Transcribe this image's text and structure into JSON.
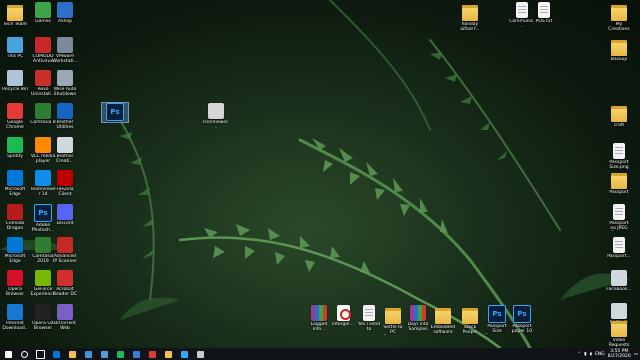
{
  "desktop": {
    "icons": [
      {
        "label": "Tech Team",
        "kind": "folder",
        "color": "#e8b740"
      },
      {
        "label": "Games",
        "kind": "app",
        "color": "#3fa34a"
      },
      {
        "label": "Ashop",
        "kind": "app",
        "color": "#2d6fc9"
      },
      {
        "label": "This PC",
        "kind": "app",
        "color": "#4aa3df"
      },
      {
        "label": "COMODO Antivirus",
        "kind": "app",
        "color": "#c62828"
      },
      {
        "label": "VMware Workstati...",
        "kind": "app",
        "color": "#7a8a9a"
      },
      {
        "label": "Recycle Bin",
        "kind": "app",
        "color": "#b0c4d8"
      },
      {
        "label": "Revo Uninstall...",
        "kind": "app",
        "color": "#c9302c"
      },
      {
        "label": "Wise Auto Shutdown",
        "kind": "app",
        "color": "#9aa7b4"
      },
      {
        "label": "Google Chrome",
        "kind": "app",
        "color": "#e53935"
      },
      {
        "label": "Camtasia 8",
        "kind": "app",
        "color": "#2e7d32"
      },
      {
        "label": "Brother Utilities",
        "kind": "app",
        "color": "#1565c0"
      },
      {
        "label": "Spotify",
        "kind": "app",
        "color": "#1db954"
      },
      {
        "label": "VLC media player",
        "kind": "app",
        "color": "#ff8800"
      },
      {
        "label": "Brother Creati...",
        "kind": "app",
        "color": "#cfd8dc"
      },
      {
        "label": "Microsoft Edge",
        "kind": "app",
        "color": "#0078d7"
      },
      {
        "label": "TeamViewer 14",
        "kind": "app",
        "color": "#0e8ee9"
      },
      {
        "label": "FileZilla Client",
        "kind": "app",
        "color": "#bf0000"
      },
      {
        "label": "Comodo Dragon",
        "kind": "app",
        "color": "#b71c1c"
      },
      {
        "label": "Adobe Photosh...",
        "kind": "ps",
        "color": "#31a8ff"
      },
      {
        "label": "Discord",
        "kind": "app",
        "color": "#5865f2"
      },
      {
        "label": "Microsoft Edge",
        "kind": "app",
        "color": "#0078d7"
      },
      {
        "label": "Camtasia 2019",
        "kind": "app",
        "color": "#2e7d32"
      },
      {
        "label": "Advanced IP Scanner",
        "kind": "app",
        "color": "#c62828"
      },
      {
        "label": "Opera Browser",
        "kind": "app",
        "color": "#d4112b"
      },
      {
        "label": "GeForce Experience",
        "kind": "app",
        "color": "#76b900"
      },
      {
        "label": "Acrobat Reader DC",
        "kind": "app",
        "color": "#d32f2f"
      },
      {
        "label": "Internet Download...",
        "kind": "app",
        "color": "#1976d2"
      },
      {
        "label": "Opera GX Browser",
        "kind": "app",
        "color": "#222222"
      },
      {
        "label": "BitTorrent Web",
        "kind": "app",
        "color": "#7b5fc4"
      },
      {
        "label": "",
        "kind": "ps",
        "color": "#31a8ff"
      },
      {
        "label": "IconViewer...",
        "kind": "app",
        "color": "#d6d6d6"
      },
      {
        "label": "holiday aifiad f...",
        "kind": "folder",
        "color": "#e8b740"
      },
      {
        "label": "Communic...",
        "kind": "doc",
        "color": "#f4f4f4"
      },
      {
        "label": "POS.txt",
        "kind": "doc",
        "color": "#f4f4f4"
      },
      {
        "label": "My Creations",
        "kind": "folder",
        "color": "#e8b740"
      },
      {
        "label": "Backup",
        "kind": "folder",
        "color": "#e8b740"
      },
      {
        "label": "craft",
        "kind": "folder",
        "color": "#e8b740"
      },
      {
        "label": "Passport Size.png",
        "kind": "doc",
        "color": "#f4f4f4"
      },
      {
        "label": "Passport",
        "kind": "folder",
        "color": "#e8b740"
      },
      {
        "label": "Passport ea JPEG Open...",
        "kind": "doc",
        "color": "#f4f4f4"
      },
      {
        "label": "Passport...",
        "kind": "doc",
        "color": "#f4f4f4"
      },
      {
        "label": "Facebook...",
        "kind": "app",
        "color": "#cfd8dc"
      },
      {
        "label": "bedrock ex...",
        "kind": "app",
        "color": "#cfd8dc"
      },
      {
        "label": "Video Requests xx...",
        "kind": "folder",
        "color": "#e8b740"
      },
      {
        "label": "Logged info...",
        "kind": "rar",
        "color": "#a03a9a"
      },
      {
        "label": "Interger...",
        "kind": "pdf",
        "color": "#d82020"
      },
      {
        "label": "Yes I send to people.txt",
        "kind": "doc",
        "color": "#f4f4f4"
      },
      {
        "label": "Settle to PC Samples",
        "kind": "folder",
        "color": "#e8b740"
      },
      {
        "label": "Dayr into Samples",
        "kind": "rar",
        "color": "#a03a9a"
      },
      {
        "label": "Embedded software",
        "kind": "folder",
        "color": "#e8b740"
      },
      {
        "label": "Stock People",
        "kind": "folder",
        "color": "#e8b740"
      },
      {
        "label": "Passport Size Picture.psd",
        "kind": "ps",
        "color": "#31a8ff"
      },
      {
        "label": "Passport paper 10 c...",
        "kind": "ps",
        "color": "#31a8ff"
      }
    ]
  },
  "taskbar": {
    "apps": [
      {
        "name": "start-button",
        "color": "#ffffff"
      },
      {
        "name": "search-icon",
        "color": "#ffffff"
      },
      {
        "name": "task-view-icon",
        "color": "#ffffff"
      },
      {
        "name": "edge-taskbar-icon",
        "color": "#0078d7"
      },
      {
        "name": "file-explorer-icon",
        "color": "#f2c14e"
      },
      {
        "name": "store-icon",
        "color": "#3a96dd"
      },
      {
        "name": "mail-icon",
        "color": "#5b9bd5"
      },
      {
        "name": "spotify-taskbar-icon",
        "color": "#1db954"
      },
      {
        "name": "photos-icon",
        "color": "#3c7dd9"
      },
      {
        "name": "chrome-taskbar-icon",
        "color": "#e53935"
      },
      {
        "name": "folder-taskbar-icon",
        "color": "#f2c14e"
      },
      {
        "name": "photoshop-taskbar-icon",
        "color": "#31a8ff"
      },
      {
        "name": "settings-taskbar-icon",
        "color": "#cccccc"
      }
    ],
    "tray": {
      "lang": "ENG",
      "time": "3:55 PM",
      "date": "8/27/2020"
    }
  }
}
